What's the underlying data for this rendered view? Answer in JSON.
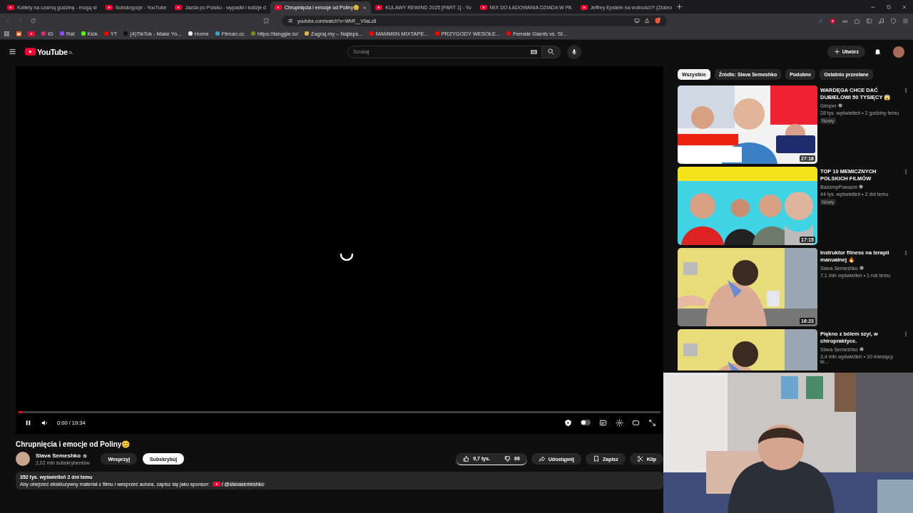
{
  "browser": {
    "tabs": [
      {
        "title": "Kotlety na czarną godzinę - mogą st",
        "selected": false
      },
      {
        "title": "Subskrypcje - YouTube",
        "selected": false
      },
      {
        "title": "Jazda po Polsku - wypadki i kolizje d",
        "selected": false
      },
      {
        "title": "Chrupnięcia i emocje od Poliny😊",
        "selected": true
      },
      {
        "title": "KULAWY REWIND 2025 [PART 1] - Yo",
        "selected": false
      },
      {
        "title": "MIX DO ŁADOWANIA DZIADA W PA",
        "selected": false
      },
      {
        "title": "Jeffrey Epstein na wolności?! (Ziobro",
        "selected": false
      }
    ],
    "address": "youtube.com/watch?v=WhR__V0aLz8",
    "bookmarks": [
      {
        "label": "IG",
        "color": "#d62976"
      },
      {
        "label": "Rat",
        "color": "#9146ff"
      },
      {
        "label": "Kick",
        "color": "#53fc18"
      },
      {
        "label": "YT",
        "color": "#ff0000"
      },
      {
        "label": "(4)TikTok - Make Yo...",
        "color": "#111111"
      },
      {
        "label": "Home",
        "color": "#e7e9ea"
      },
      {
        "label": "Filman.cc",
        "color": "#3aa0c8"
      },
      {
        "label": "https://tanggle.io/",
        "color": "#6b8e23"
      },
      {
        "label": "Zagraj.my – Najleps...",
        "color": "#e0b040"
      },
      {
        "label": "MAMM0N MIXTAPE...",
        "color": "#ff0000"
      },
      {
        "label": "PRZYGODY WESOŁE...",
        "color": "#ff0000"
      },
      {
        "label": "Female Giants vs. St...",
        "color": "#ff0000"
      }
    ]
  },
  "header": {
    "logo": "YouTube",
    "region": "PL",
    "search": {
      "placeholder": "Szukaj"
    },
    "create": "Utwórz"
  },
  "player": {
    "playing": true,
    "loading": true,
    "autoplay": false,
    "progress": {
      "level": 0.006
    },
    "time": "0:00 / 19:34"
  },
  "video": {
    "title": "Chrupnięcia i emocje od Poliny😊",
    "channel": "Slava Semeshko",
    "verified": true,
    "subscribers": "2,02 mln subskrybentów",
    "support": "Wesprzyj",
    "subscribe": "Subskrybuj",
    "actions": [
      {
        "kind": "like",
        "label": "9,7 tys."
      },
      {
        "kind": "dislike",
        "label": "66"
      },
      {
        "kind": "share",
        "label": "Udostępnij"
      },
      {
        "kind": "save",
        "label": "Zapisz"
      },
      {
        "kind": "clip",
        "label": "Klip"
      }
    ],
    "stats": "352 tys. wyświetleń  2 dni temu",
    "description": "Aby obejrzeć ekskluzywny materiał z filmu i wesprzeć autora, zapisz się jako sponsor:",
    "handle": "/ @slavasemeshko"
  },
  "sidebar": {
    "chips": [
      {
        "label": "Wszystkie",
        "selected": true
      },
      {
        "label": "Źródło: Slava Semeshko",
        "selected": false
      },
      {
        "label": "Podobne",
        "selected": false
      },
      {
        "label": "Ostatnio przesłane",
        "selected": false
      }
    ],
    "videos": [
      {
        "title": "WARDĘGA CHCE DAĆ DUBIELOWI 50 TYSIĘCY 😱",
        "channel": "Gimper",
        "verified": true,
        "meta": "28 tys. wyświetleń • 2 godziny temu",
        "badge": "Nowy",
        "duration": "27:18"
      },
      {
        "title": "TOP 10 MEMICZNYCH POLSKICH FILMÓW",
        "channel": "BadzmyPowazni",
        "verified": true,
        "meta": "44 tys. wyświetleń • 2 dni temu",
        "badge": "Nowy",
        "duration": "17:15"
      },
      {
        "title": "Instruktor fitness na terapii manualnej 🔥",
        "channel": "Slava Semeshko",
        "verified": true,
        "meta": "7,1 mln wyświetleń • 1 rok temu",
        "duration": "16:23"
      },
      {
        "title": "Piękno z bólem szyi, w chiropraktyce.",
        "channel": "Slava Semeshko",
        "verified": true,
        "meta": "3,4 mln wyświetleń • 10 miesięcy te..."
      }
    ]
  }
}
